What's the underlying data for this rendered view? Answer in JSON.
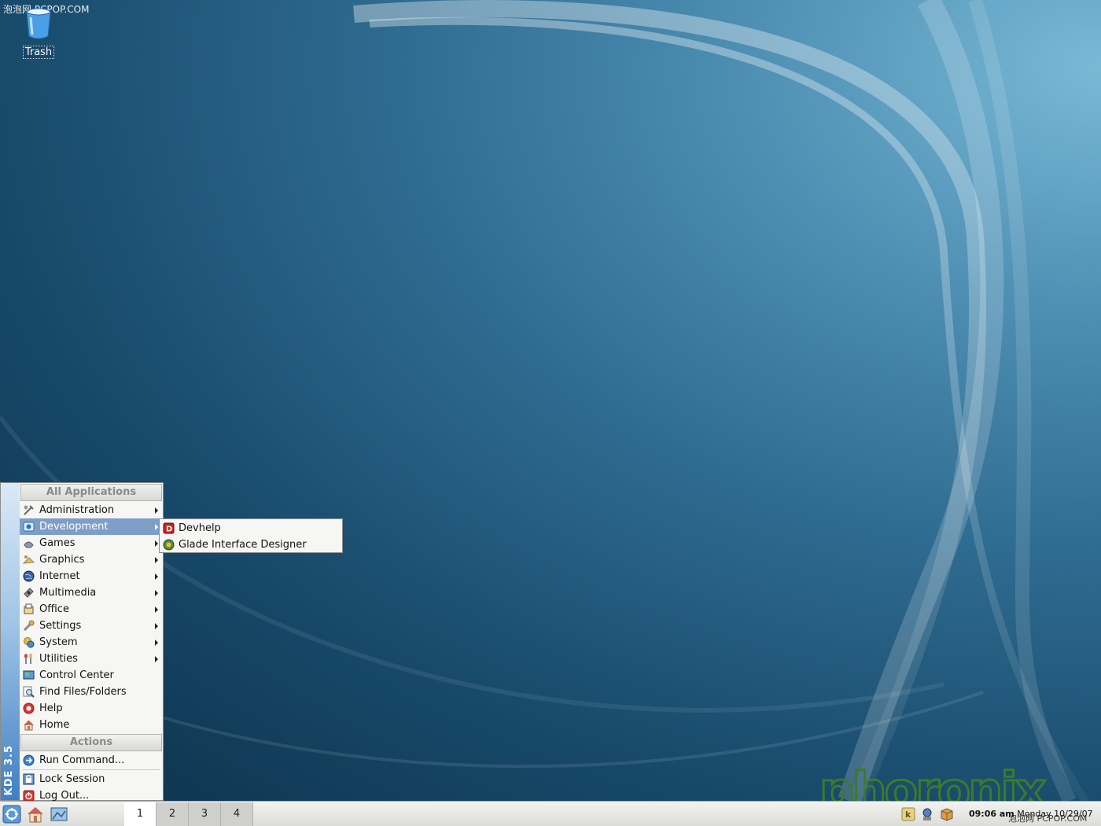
{
  "watermark": "泡泡网 PCPOP.COM",
  "desktop": {
    "icons": [
      {
        "label": "Trash",
        "icon": "trash-icon"
      }
    ],
    "brand": "phoronix"
  },
  "kmenu": {
    "side_label": "KDE 3.5",
    "section_all": "All Applications",
    "apps": [
      {
        "label": "Administration",
        "icon": "administration-icon",
        "submenu": true
      },
      {
        "label": "Development",
        "icon": "development-icon",
        "submenu": true,
        "selected": true
      },
      {
        "label": "Games",
        "icon": "games-icon",
        "submenu": true
      },
      {
        "label": "Graphics",
        "icon": "graphics-icon",
        "submenu": true
      },
      {
        "label": "Internet",
        "icon": "internet-icon",
        "submenu": true
      },
      {
        "label": "Multimedia",
        "icon": "multimedia-icon",
        "submenu": true
      },
      {
        "label": "Office",
        "icon": "office-icon",
        "submenu": true
      },
      {
        "label": "Settings",
        "icon": "settings-icon",
        "submenu": true
      },
      {
        "label": "System",
        "icon": "system-icon",
        "submenu": true
      },
      {
        "label": "Utilities",
        "icon": "utilities-icon",
        "submenu": true
      },
      {
        "label": "Control Center",
        "icon": "control-center-icon"
      },
      {
        "label": "Find Files/Folders",
        "icon": "find-files-icon"
      },
      {
        "label": "Help",
        "icon": "help-icon"
      },
      {
        "label": "Home",
        "icon": "home-icon"
      }
    ],
    "section_actions": "Actions",
    "actions": [
      {
        "label": "Run Command...",
        "icon": "run-command-icon"
      },
      {
        "label": "Lock Session",
        "icon": "lock-session-icon"
      },
      {
        "label": "Log Out...",
        "icon": "log-out-icon"
      }
    ]
  },
  "submenu": {
    "items": [
      {
        "label": "Devhelp",
        "icon": "devhelp-icon"
      },
      {
        "label": "Glade Interface Designer",
        "icon": "glade-icon"
      }
    ]
  },
  "taskbar": {
    "desktops": [
      "1",
      "2",
      "3",
      "4"
    ],
    "active_desktop": "1",
    "clock_time": "09:06 am",
    "clock_date": "Monday 10/29/07"
  },
  "colors": {
    "menu_highlight": "#7e9ec7",
    "brand_green": "#3d7a2a"
  }
}
